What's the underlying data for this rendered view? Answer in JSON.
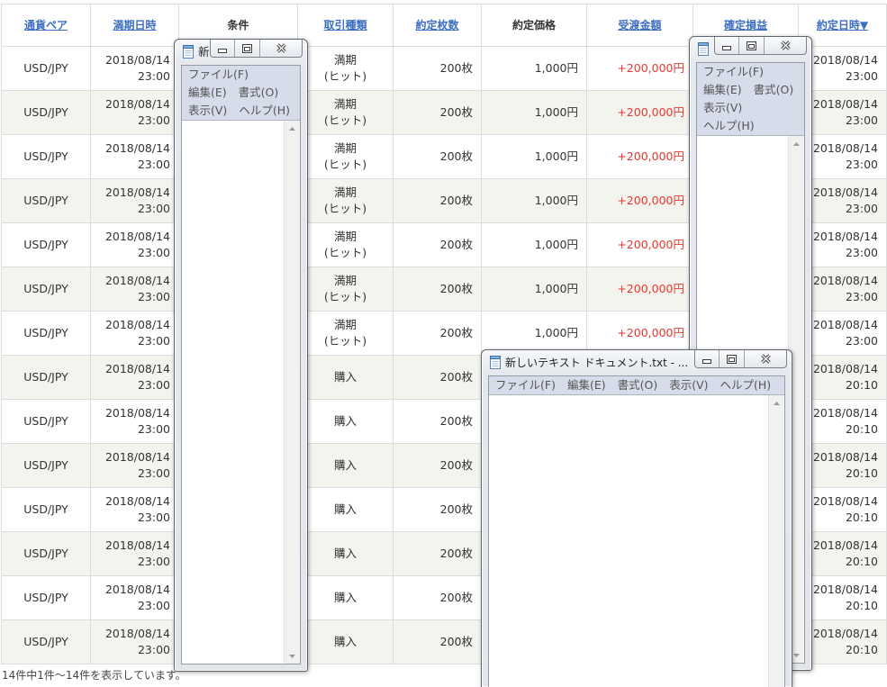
{
  "table": {
    "headers": {
      "pair": "通貨ペア",
      "expiry": "満期日時",
      "condition": "条件",
      "trade_type": "取引種類",
      "quantity": "約定枚数",
      "price": "約定価格",
      "amount": "受渡金額",
      "pnl": "確定損益",
      "exec_datetime": "約定日時▼"
    },
    "rows": [
      {
        "pair": "USD/JPY",
        "expiry_date": "2018/08/14",
        "expiry_time": "23:00",
        "type_main": "満期",
        "type_sub": "(ヒット)",
        "quantity": "200枚",
        "price": "1,000円",
        "amount": "+200,000円",
        "exec_date": "2018/08/14",
        "exec_time": "23:00"
      },
      {
        "pair": "USD/JPY",
        "expiry_date": "2018/08/14",
        "expiry_time": "23:00",
        "type_main": "満期",
        "type_sub": "(ヒット)",
        "quantity": "200枚",
        "price": "1,000円",
        "amount": "+200,000円",
        "exec_date": "2018/08/14",
        "exec_time": "23:00"
      },
      {
        "pair": "USD/JPY",
        "expiry_date": "2018/08/14",
        "expiry_time": "23:00",
        "type_main": "満期",
        "type_sub": "(ヒット)",
        "quantity": "200枚",
        "price": "1,000円",
        "amount": "+200,000円",
        "exec_date": "2018/08/14",
        "exec_time": "23:00"
      },
      {
        "pair": "USD/JPY",
        "expiry_date": "2018/08/14",
        "expiry_time": "23:00",
        "type_main": "満期",
        "type_sub": "(ヒット)",
        "quantity": "200枚",
        "price": "1,000円",
        "amount": "+200,000円",
        "exec_date": "2018/08/14",
        "exec_time": "23:00"
      },
      {
        "pair": "USD/JPY",
        "expiry_date": "2018/08/14",
        "expiry_time": "23:00",
        "type_main": "満期",
        "type_sub": "(ヒット)",
        "quantity": "200枚",
        "price": "1,000円",
        "amount": "+200,000円",
        "exec_date": "2018/08/14",
        "exec_time": "23:00"
      },
      {
        "pair": "USD/JPY",
        "expiry_date": "2018/08/14",
        "expiry_time": "23:00",
        "type_main": "満期",
        "type_sub": "(ヒット)",
        "quantity": "200枚",
        "price": "1,000円",
        "amount": "+200,000円",
        "exec_date": "2018/08/14",
        "exec_time": "23:00"
      },
      {
        "pair": "USD/JPY",
        "expiry_date": "2018/08/14",
        "expiry_time": "23:00",
        "type_main": "満期",
        "type_sub": "(ヒット)",
        "quantity": "200枚",
        "price": "1,000円",
        "amount": "+200,000円",
        "exec_date": "2018/08/14",
        "exec_time": "23:00"
      },
      {
        "pair": "USD/JPY",
        "expiry_date": "2018/08/14",
        "expiry_time": "23:00",
        "type_main": "購入",
        "quantity": "200枚",
        "exec_date": "2018/08/14",
        "exec_time": "20:10"
      },
      {
        "pair": "USD/JPY",
        "expiry_date": "2018/08/14",
        "expiry_time": "23:00",
        "type_main": "購入",
        "quantity": "200枚",
        "exec_date": "2018/08/14",
        "exec_time": "20:10"
      },
      {
        "pair": "USD/JPY",
        "expiry_date": "2018/08/14",
        "expiry_time": "23:00",
        "type_main": "購入",
        "quantity": "200枚",
        "exec_date": "2018/08/14",
        "exec_time": "20:10"
      },
      {
        "pair": "USD/JPY",
        "expiry_date": "2018/08/14",
        "expiry_time": "23:00",
        "type_main": "購入",
        "quantity": "200枚",
        "exec_date": "2018/08/14",
        "exec_time": "20:10"
      },
      {
        "pair": "USD/JPY",
        "expiry_date": "2018/08/14",
        "expiry_time": "23:00",
        "type_main": "購入",
        "quantity": "200枚",
        "exec_date": "2018/08/14",
        "exec_time": "20:10"
      },
      {
        "pair": "USD/JPY",
        "expiry_date": "2018/08/14",
        "expiry_time": "23:00",
        "type_main": "購入",
        "quantity": "200枚",
        "exec_date": "2018/08/14",
        "exec_time": "20:10"
      },
      {
        "pair": "USD/JPY",
        "expiry_date": "2018/08/14",
        "expiry_time": "23:00",
        "type_main": "購入",
        "quantity": "200枚",
        "exec_date": "2018/08/14",
        "exec_time": "20:10"
      }
    ]
  },
  "footer_text": "14件中1件～14件を表示しています。",
  "notepad": {
    "menu": [
      "ファイル(F)",
      "編集(E)",
      "書式(O)",
      "表示(V)",
      "ヘルプ(H)"
    ],
    "windows": [
      {
        "title": "新"
      },
      {},
      {
        "title": "新しいテキスト ドキュメント.txt - ..."
      }
    ]
  },
  "colors": {
    "link": "#3c6fc1",
    "positive": "#e8372f",
    "alt_row": "#f4f4ef",
    "menu_bg": "#d7dceb"
  }
}
